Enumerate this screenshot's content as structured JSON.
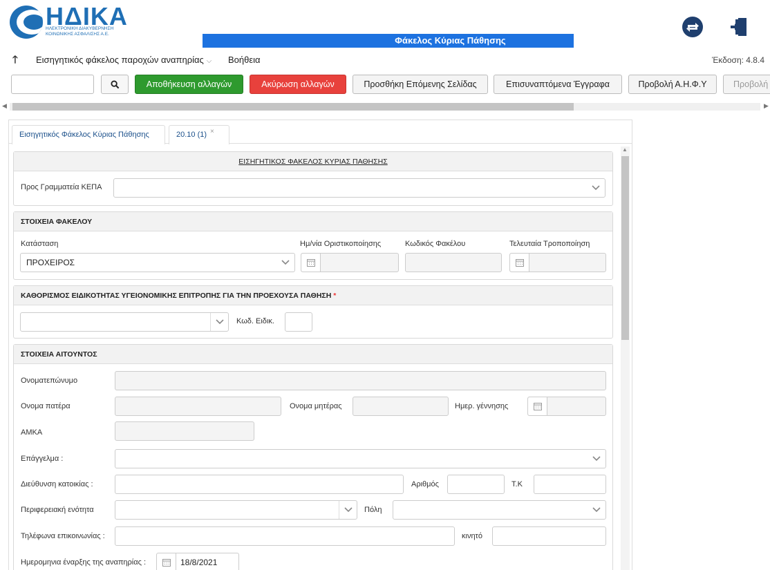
{
  "header": {
    "logo_text": "ΗΔΙΚΑ",
    "logo_sub": "ΗΛΕΚΤΡΟΝΙΚΗ ΔΙΑΚΥΒΕΡΝΗΣΗ ΚΟΙΝΩΝΙΚΗΣ ΑΣΦΑΛΙΣΗΣ Α.Ε.",
    "banner_title": "Φάκελος Κύριας Πάθησης",
    "brand_color": "#1f6fb5",
    "banner_color": "#1d72e0"
  },
  "menu": {
    "item1": "Εισηγητικός φάκελος παροχών αναπηρίας",
    "item2": "Βοήθεια",
    "version": "Έκδοση: 4.8.4"
  },
  "toolbar": {
    "search_value": "",
    "save_label": "Αποθήκευση αλλαγών",
    "cancel_label": "Ακύρωση αλλαγών",
    "add_page_label": "Προσθήκη Επόμενης Σελίδας",
    "attachments_label": "Επισυναπτόμενα Έγγραφα",
    "view_ahfy_label": "Προβολή Α.Η.Φ.Υ",
    "view_more_label": "Προβολή",
    "save_color": "#2e9a2e",
    "cancel_color": "#e8413c"
  },
  "tabs": [
    {
      "label": "Εισηγητικός Φάκελος Κύριας Πάθησης"
    },
    {
      "label": "20.10 (1)",
      "close": "×"
    }
  ],
  "section_main": {
    "title": "ΕΙΣΗΓΗΤΙΚΟΣ ΦΑΚΕΛΟΣ ΚΥΡΙΑΣ ΠΑΘΗΣΗΣ",
    "secretariat_label": "Προς Γραμματεία ΚΕΠΑ",
    "secretariat_value": ""
  },
  "section_folder": {
    "title": "ΣΤΟΙΧΕΙΑ ΦΑΚΕΛΟΥ",
    "status_label": "Κατάσταση",
    "status_value": "ΠΡΟΧΕΙΡΟΣ",
    "final_date_label": "Ημ/νία Οριστικοποίησης",
    "code_label": "Κωδικός Φακέλου",
    "last_mod_label": "Τελευταία Τροποποίηση"
  },
  "section_specialty": {
    "title": "ΚΑΘΟΡΙΣΜΟΣ ΕΙΔΙΚΟΤΗΤΑΣ ΥΓΕΙΟΝΟΜΙΚΗΣ ΕΠΙΤΡΟΠΗΣ ΓΙΑ ΤΗΝ ΠΡΟΕΧΟΥΣΑ ΠΑΘΗΣΗ",
    "required_mark": "*",
    "code_label": "Κωδ. Ειδικ."
  },
  "section_applicant": {
    "title": "ΣΤΟΙΧΕΙΑ ΑΙΤΟΥΝΤΟΣ",
    "fullname_label": "Ονοματεπώνυμο",
    "father_label": "Ονομα πατέρα",
    "mother_label": "Ονομα μητέρας",
    "birth_label": "Ημερ. γέννησης",
    "amka_label": "ΑΜΚΑ",
    "job_label": "Επάγγελμα :",
    "address_label": "Διεύθυνση κατοικίας :",
    "number_label": "Αριθμός",
    "zip_label": "Τ.Κ",
    "region_label": "Περιφερειακή ενότητα",
    "city_label": "Πόλη",
    "phone_label": "Τηλέφωνα επικοινωνίας :",
    "mobile_label": "κινητό",
    "start_date_label": "Ημερομηνια έναρξης της αναπηρίας :",
    "start_date_value": "18/8/2021"
  }
}
